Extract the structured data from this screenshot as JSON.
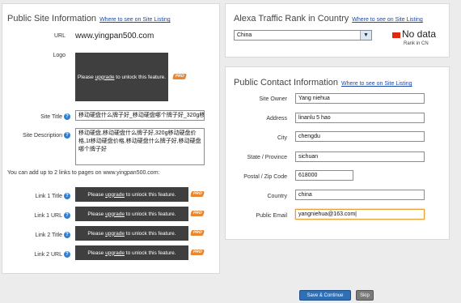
{
  "site_info": {
    "title": "Public Site Information",
    "help_link": "Where to see on Site Listing",
    "url_label": "URL",
    "url_value": "www.yingpan500.com",
    "logo_label": "Logo",
    "locked_text_1": "Please ",
    "locked_link": "upgrade",
    "locked_text_2": " to unlock this feature.",
    "site_title_label": "Site Title",
    "site_title_value": "移动硬盘什么牌子好_移动硬盘哪个牌子好_320g移",
    "site_desc_label": "Site Description",
    "site_desc_value": "移动硬盘,移动硬盘什么牌子好,320g移动硬盘价格,1t移动硬盘价格,移动硬盘什么牌子好,移动硬盘哪个牌子好",
    "links_note": "You can add up to 2 links to pages on www.yingpan500.com:",
    "link_rows": [
      {
        "label": "Link 1 Title"
      },
      {
        "label": "Link 1 URL"
      },
      {
        "label": "Link 2 Title"
      },
      {
        "label": "Link 2 URL"
      }
    ]
  },
  "alexa": {
    "title": "Alexa Traffic Rank in Country",
    "help_link": "Where to see on Site Listing",
    "country_selected": "China",
    "rank_value": "No data",
    "rank_sub": "Rank in CN"
  },
  "contact": {
    "title": "Public Contact Information",
    "help_link": "Where to see on Site Listing",
    "fields": [
      {
        "label": "Site Owner",
        "value": "Yang niehua"
      },
      {
        "label": "Address",
        "value": "linanlu 5 hao"
      },
      {
        "label": "City",
        "value": "chengdu"
      },
      {
        "label": "State / Province",
        "value": "sichuan"
      },
      {
        "label": "Postal / Zip Code",
        "value": "618000"
      },
      {
        "label": "Country",
        "value": "china"
      },
      {
        "label": "Public Email",
        "value": "yangniehua@163.com|"
      }
    ]
  },
  "actions": {
    "save_label": "Save & Continue",
    "skip_label": "Skip"
  },
  "icons": {
    "pro_badge": "PRO"
  },
  "colors": {
    "link": "#1d49a8",
    "help": "#2f7fd3",
    "save": "#2f6fb6",
    "skip": "#7a7a7a",
    "pro": "#e8872f",
    "flag": "#de2910"
  }
}
